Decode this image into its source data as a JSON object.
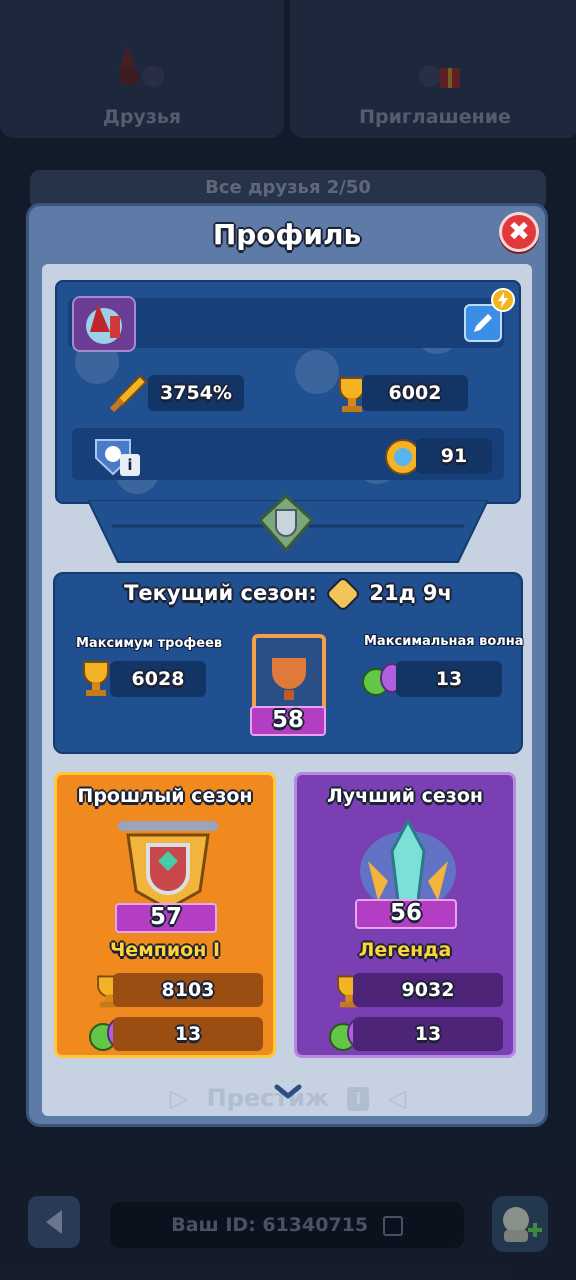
{
  "background": {
    "tabs": [
      {
        "label": "Друзья"
      },
      {
        "label": "Приглашение"
      }
    ],
    "friends_bar": "Все друзья 2/50",
    "bottom": {
      "id_text": "Ваш ID: 61340715"
    }
  },
  "modal": {
    "title": "Профиль",
    "close_glyph": "✖",
    "profile": {
      "power_value": "3754%",
      "trophies": "6002",
      "medal_value": "91"
    },
    "current_season": {
      "title_prefix": "Текущий сезон:",
      "time_left": "21д 9ч",
      "max_trophies_label": "Максимум трофеев",
      "max_trophies_value": "6028",
      "max_wave_label": "Максимальная волна",
      "max_wave_value": "13",
      "level": "58"
    },
    "past_season": {
      "title": "Прошлый сезон",
      "level": "57",
      "rank": "Чемпион I",
      "trophies": "8103",
      "wave": "13"
    },
    "best_season": {
      "title": "Лучший сезон",
      "level": "56",
      "rank": "Легенда",
      "trophies": "9032",
      "wave": "13"
    },
    "prestige_label": "Престиж"
  },
  "colors": {
    "accent_blue": "#20508f",
    "close_red": "#e0393d",
    "rank_yellow": "#ffd33a",
    "ribbon_purple": "#b33ec4"
  }
}
